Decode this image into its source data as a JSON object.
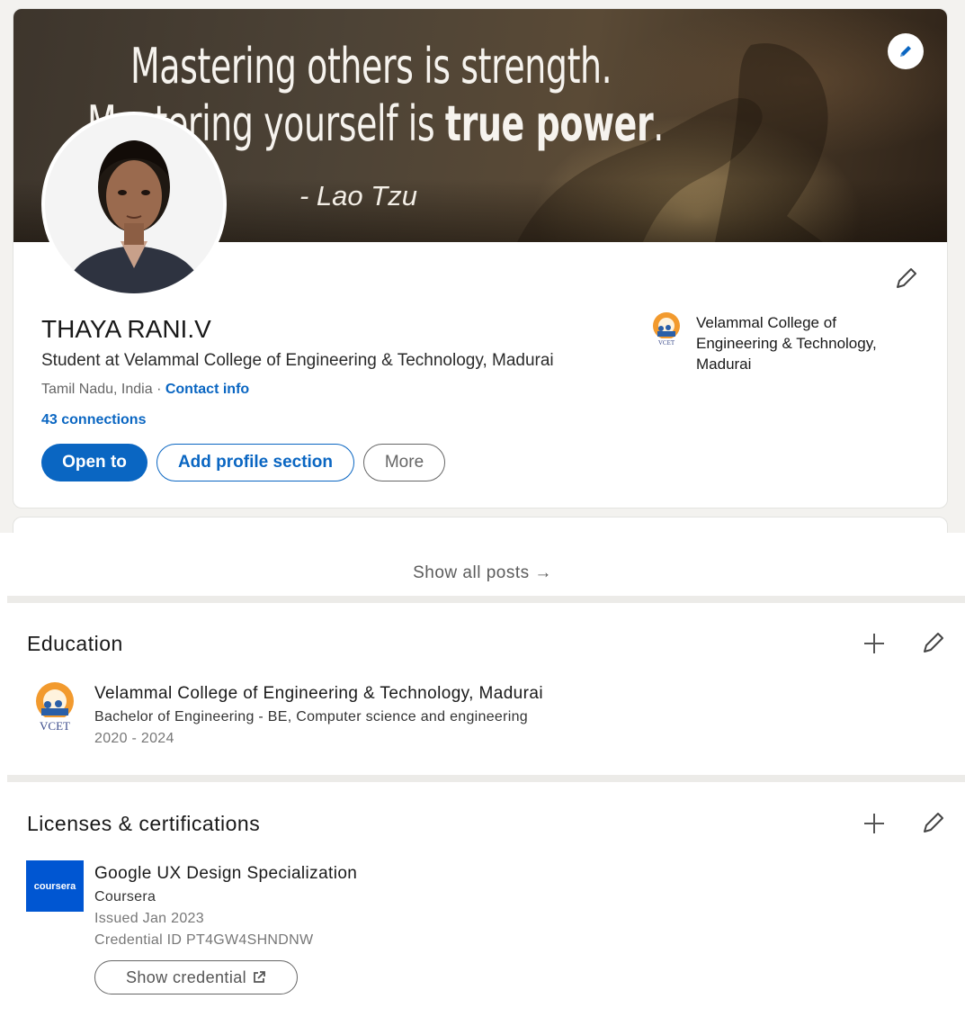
{
  "banner": {
    "quote_line1": "Mastering others is strength.",
    "quote_line2_start": "Mastering yourself is ",
    "quote_line2_bold": "true power",
    "quote_line2_end": ".",
    "quote_author": "- Lao Tzu"
  },
  "profile": {
    "name": "THAYA RANI.V",
    "headline": "Student at Velammal College of Engineering & Technology, Madurai",
    "location": "Tamil Nadu, India · ",
    "contact_info": "Contact info",
    "connections": "43 connections",
    "school": "Velammal College of Engineering & Technology, Madurai"
  },
  "actions": {
    "open_to": "Open to",
    "add_section": "Add profile section",
    "more": "More"
  },
  "posts": {
    "show_all": "Show all posts →"
  },
  "education": {
    "title": "Education",
    "items": [
      {
        "school": "Velammal College of Engineering & Technology, Madurai",
        "degree": "Bachelor of Engineering - BE, Computer science and engineering",
        "dates": "2020 - 2024",
        "logo_text": "VCET"
      }
    ]
  },
  "licenses": {
    "title": "Licenses & certifications",
    "items": [
      {
        "name": "Google UX Design Specialization",
        "issuer": "Coursera",
        "issued": "Issued Jan 2023",
        "credential_id": "Credential ID PT4GW4SHNDNW",
        "logo_text": "coursera",
        "show_credential": "Show credential"
      }
    ]
  },
  "colors": {
    "brand_blue": "#0a66c2",
    "coursera_blue": "#0056d2",
    "page_bg": "#f3f2ef"
  }
}
